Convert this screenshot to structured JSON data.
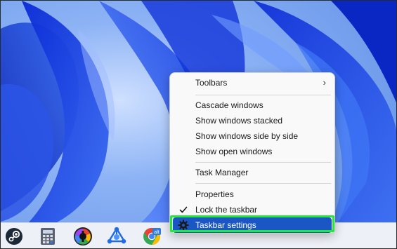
{
  "desktop": {
    "wallpaper": "Windows 11 blue bloom",
    "accent_color": "#1b57c4",
    "highlight_color": "#22e83a"
  },
  "context_menu": {
    "items": [
      {
        "label": "Toolbars",
        "submenu_icon": "chevron-right-icon"
      },
      {
        "label": "Cascade windows"
      },
      {
        "label": "Show windows stacked"
      },
      {
        "label": "Show windows side by side"
      },
      {
        "label": "Show open windows"
      },
      {
        "label": "Task Manager"
      },
      {
        "label": "Properties"
      },
      {
        "label": "Lock the taskbar",
        "checked": true,
        "icon": "checkmark-icon"
      },
      {
        "label": "Taskbar settings",
        "icon": "gear-icon",
        "selected": true
      }
    ]
  },
  "taskbar": {
    "apps": [
      {
        "name": "steam-icon"
      },
      {
        "name": "calculator-icon"
      },
      {
        "name": "pinwheel-app-icon"
      },
      {
        "name": "triangle-hub-icon"
      },
      {
        "name": "chrome-canary-icon",
        "badge": "alt"
      }
    ]
  }
}
